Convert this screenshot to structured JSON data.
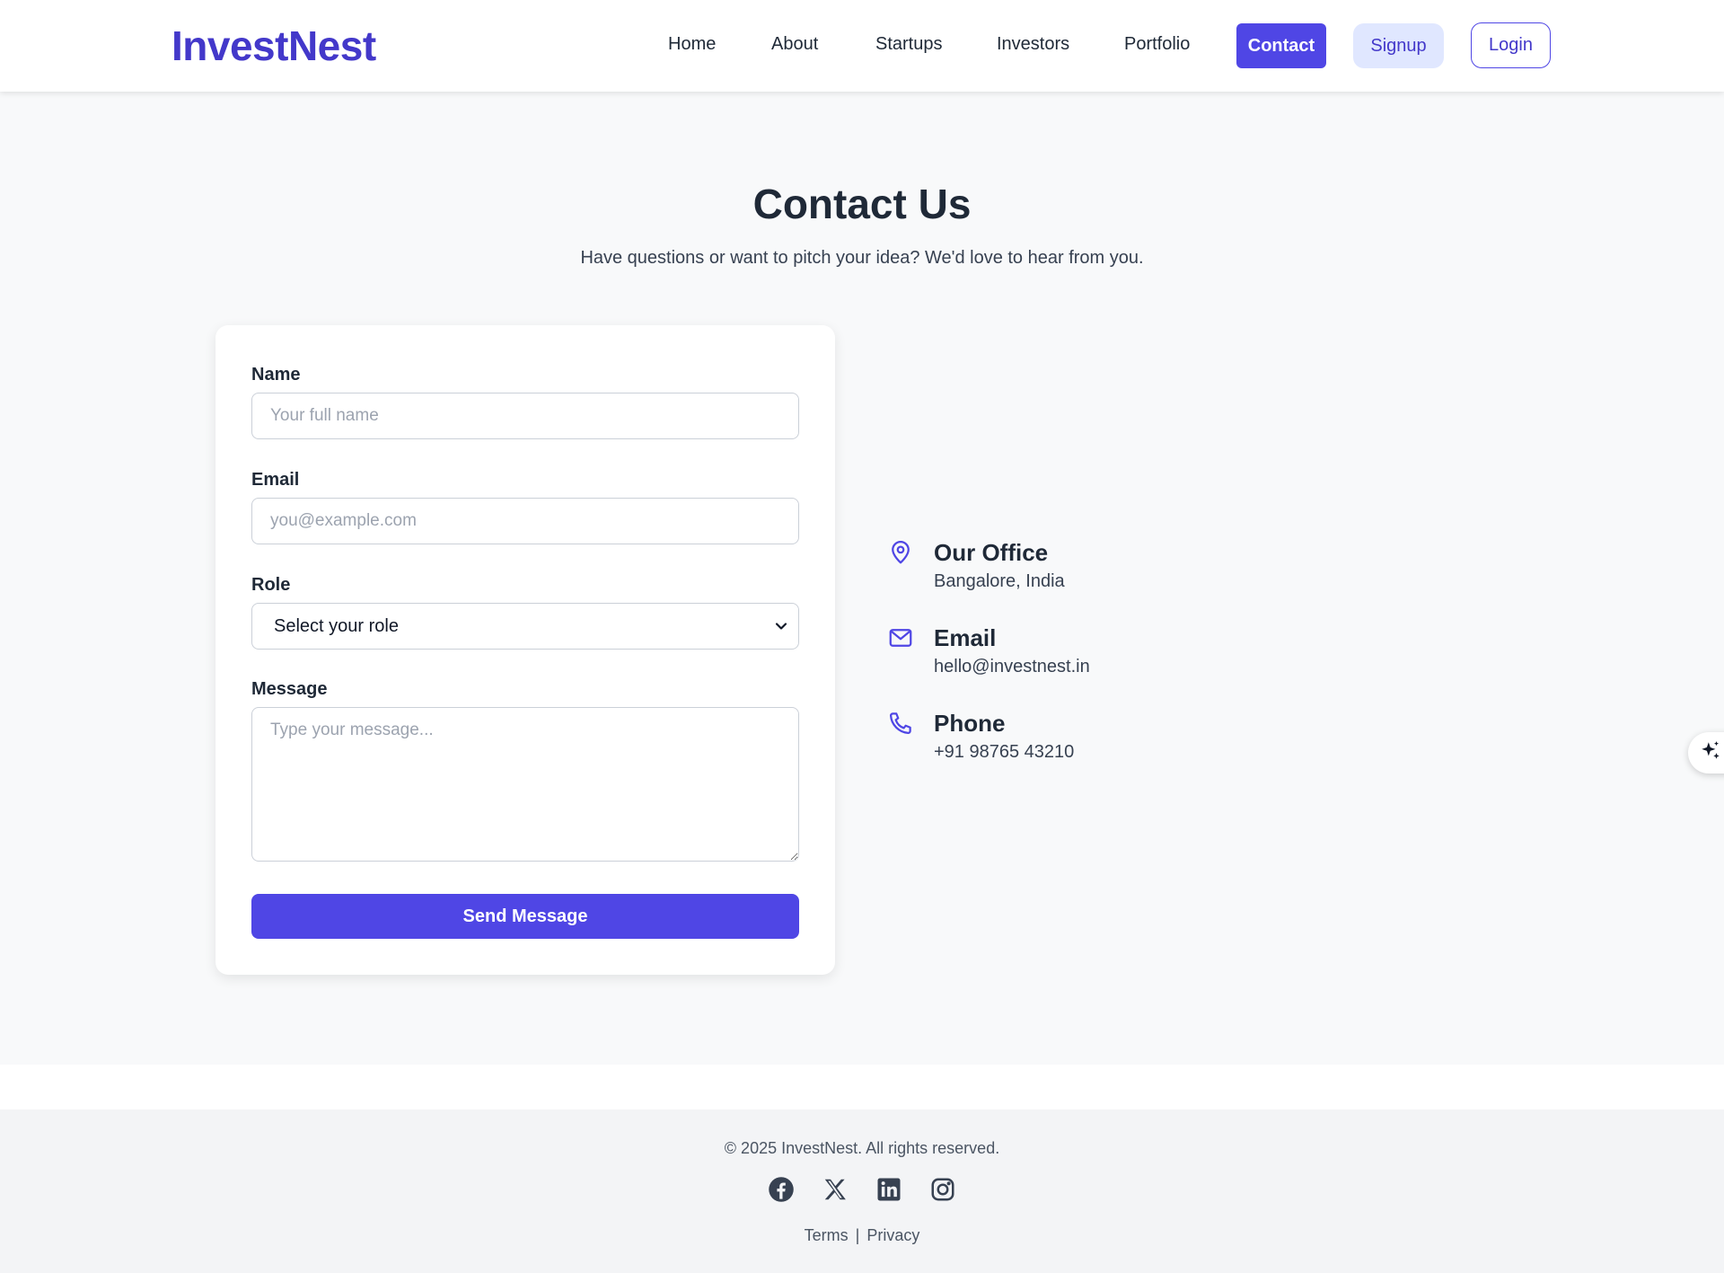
{
  "header": {
    "logo": "InvestNest",
    "nav": [
      "Home",
      "About",
      "Startups",
      "Investors",
      "Portfolio"
    ],
    "contact_label": "Contact",
    "signup_label": "Signup",
    "login_label": "Login"
  },
  "hero": {
    "title": "Contact Us",
    "subtitle": "Have questions or want to pitch your idea? We'd love to hear from you."
  },
  "form": {
    "name_label": "Name",
    "name_placeholder": "Your full name",
    "email_label": "Email",
    "email_placeholder": "you@example.com",
    "role_label": "Role",
    "role_selected": "Select your role",
    "message_label": "Message",
    "message_placeholder": "Type your message...",
    "submit_label": "Send Message"
  },
  "contact_info": [
    {
      "icon": "map-pin-icon",
      "title": "Our Office",
      "value": "Bangalore, India"
    },
    {
      "icon": "mail-icon",
      "title": "Email",
      "value": "hello@investnest.in"
    },
    {
      "icon": "phone-icon",
      "title": "Phone",
      "value": "+91 98765 43210"
    }
  ],
  "footer": {
    "copyright": "© 2025 InvestNest. All rights reserved.",
    "social": [
      "facebook-icon",
      "x-icon",
      "linkedin-icon",
      "instagram-icon"
    ],
    "terms_label": "Terms",
    "separator": "|",
    "privacy_label": "Privacy"
  },
  "colors": {
    "brand": "#4338ca",
    "primary_button": "#4f46e5",
    "signup_bg": "#e0e7ff",
    "page_bg": "#f8f9fa",
    "footer_bg": "#f3f4f6"
  }
}
